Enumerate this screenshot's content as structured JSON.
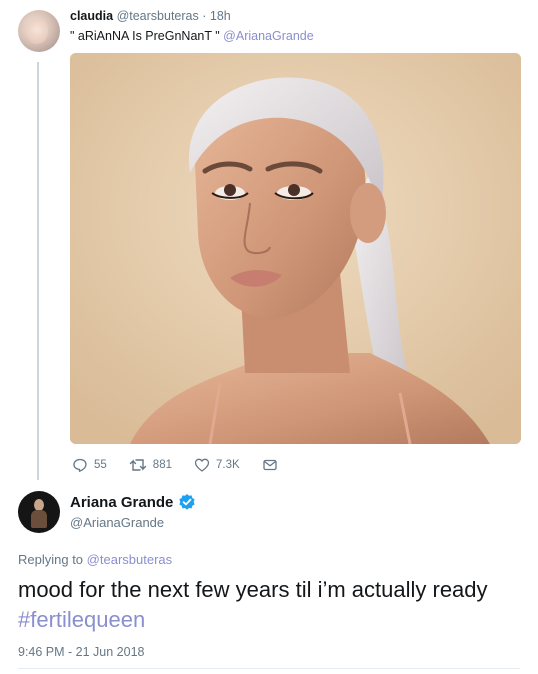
{
  "original_tweet": {
    "display_name": "claudia",
    "handle": "@tearsbuteras",
    "separator": "·",
    "time_ago": "18h",
    "text": "\" aRiAnNA Is PreGnNanT \"",
    "mention": "@ArianaGrande",
    "actions": {
      "replies": "55",
      "retweets": "881",
      "likes": "7.3K"
    }
  },
  "reply_tweet": {
    "display_name": "Ariana Grande",
    "handle": "@ArianaGrande",
    "replying_to_label": "Replying to",
    "replying_to_handle": "@tearsbuteras",
    "text": "mood for the next few years til i’m actually ready",
    "hashtag": "#fertilequeen",
    "timestamp": "9:46 PM - 21 Jun 2018"
  },
  "icons": [
    "reply-icon",
    "retweet-icon",
    "like-icon",
    "message-icon",
    "verified-badge-icon"
  ],
  "colors": {
    "link": "#8a8fce",
    "secondary_text": "#657786",
    "verified": "#1da1f2",
    "thread_line": "#ccd6dd"
  }
}
